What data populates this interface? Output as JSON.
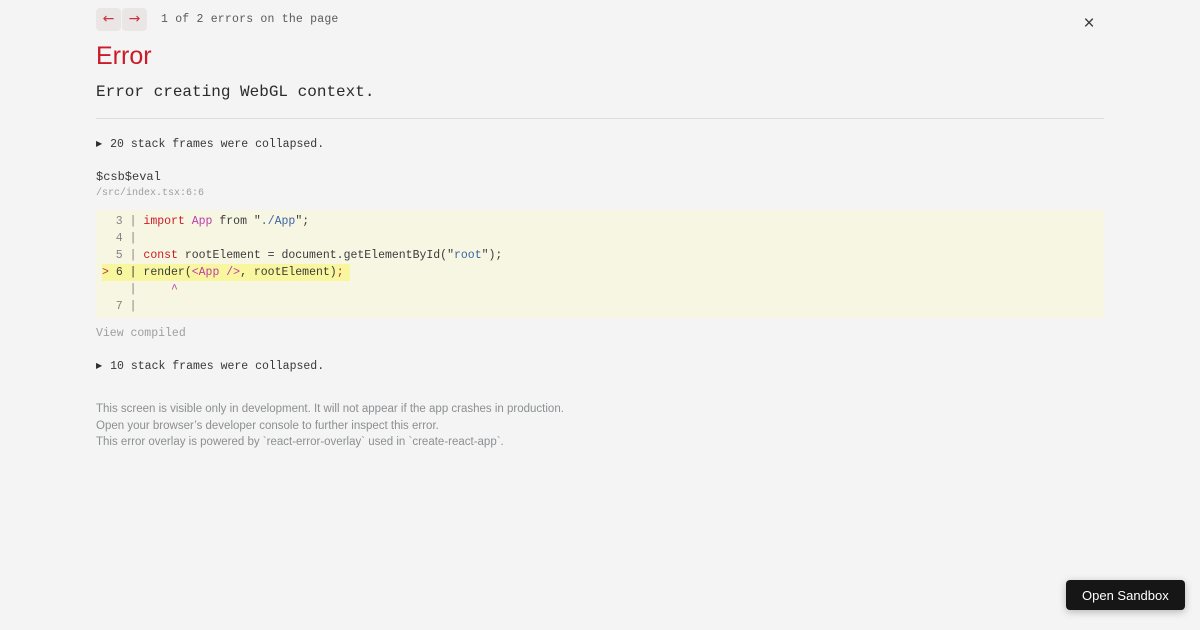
{
  "nav": {
    "prev_icon": "←",
    "next_icon": "→",
    "counter": "1 of 2 errors on the page",
    "close_icon": "×"
  },
  "error": {
    "title": "Error",
    "message": "Error creating WebGL context."
  },
  "stack": {
    "expand_icon": "▶",
    "collapsed_top": "20 stack frames were collapsed.",
    "function_name": "$csb$eval",
    "location": "/src/index.tsx:6:6",
    "view_compiled": "View compiled",
    "collapsed_bottom": "10 stack frames were collapsed."
  },
  "code_frame": {
    "lines": [
      {
        "highlight": false,
        "tokens": [
          [
            "g",
            "  3 | "
          ],
          [
            "k",
            "import"
          ],
          [
            "p",
            " "
          ],
          [
            "j",
            "App"
          ],
          [
            "p",
            " from "
          ],
          [
            "p",
            "\""
          ],
          [
            "s",
            "./App"
          ],
          [
            "p",
            "\";"
          ]
        ]
      },
      {
        "highlight": false,
        "tokens": [
          [
            "g",
            "  4 |"
          ]
        ]
      },
      {
        "highlight": false,
        "tokens": [
          [
            "g",
            "  5 | "
          ],
          [
            "k",
            "const"
          ],
          [
            "p",
            " rootElement = document.getElementById("
          ],
          [
            "p",
            "\""
          ],
          [
            "s",
            "root"
          ],
          [
            "p",
            "\");"
          ]
        ]
      },
      {
        "highlight": true,
        "tokens": [
          [
            "m",
            "> "
          ],
          [
            "gd",
            "6 | "
          ],
          [
            "p",
            "render("
          ],
          [
            "j",
            "<App"
          ],
          [
            "p",
            " "
          ],
          [
            "j",
            "/>"
          ],
          [
            "p",
            ", rootElement)"
          ],
          [
            "k",
            ";"
          ]
        ]
      },
      {
        "highlight": false,
        "tokens": [
          [
            "g",
            "    | "
          ],
          [
            "p",
            "    "
          ],
          [
            "c",
            "^"
          ]
        ]
      },
      {
        "highlight": false,
        "tokens": [
          [
            "g",
            "  7 |"
          ]
        ]
      }
    ]
  },
  "footer": {
    "line1": "This screen is visible only in development. It will not appear if the app crashes in production.",
    "line2": "Open your browser’s developer console to further inspect this error.",
    "line3": "This error overlay is powered by `react-error-overlay` used in `create-react-app`."
  },
  "open_sandbox": {
    "label": "Open Sandbox"
  },
  "colors": {
    "page_background": "#f4f4f4",
    "accent_red": "#cb1b28",
    "jsx_magenta": "#be3caa",
    "string_blue": "#3c64a4",
    "code_background": "#f6f6e3",
    "code_highlight": "#f8f69e",
    "button_background": "#161616",
    "nav_button_background": "#ebe6e6"
  }
}
